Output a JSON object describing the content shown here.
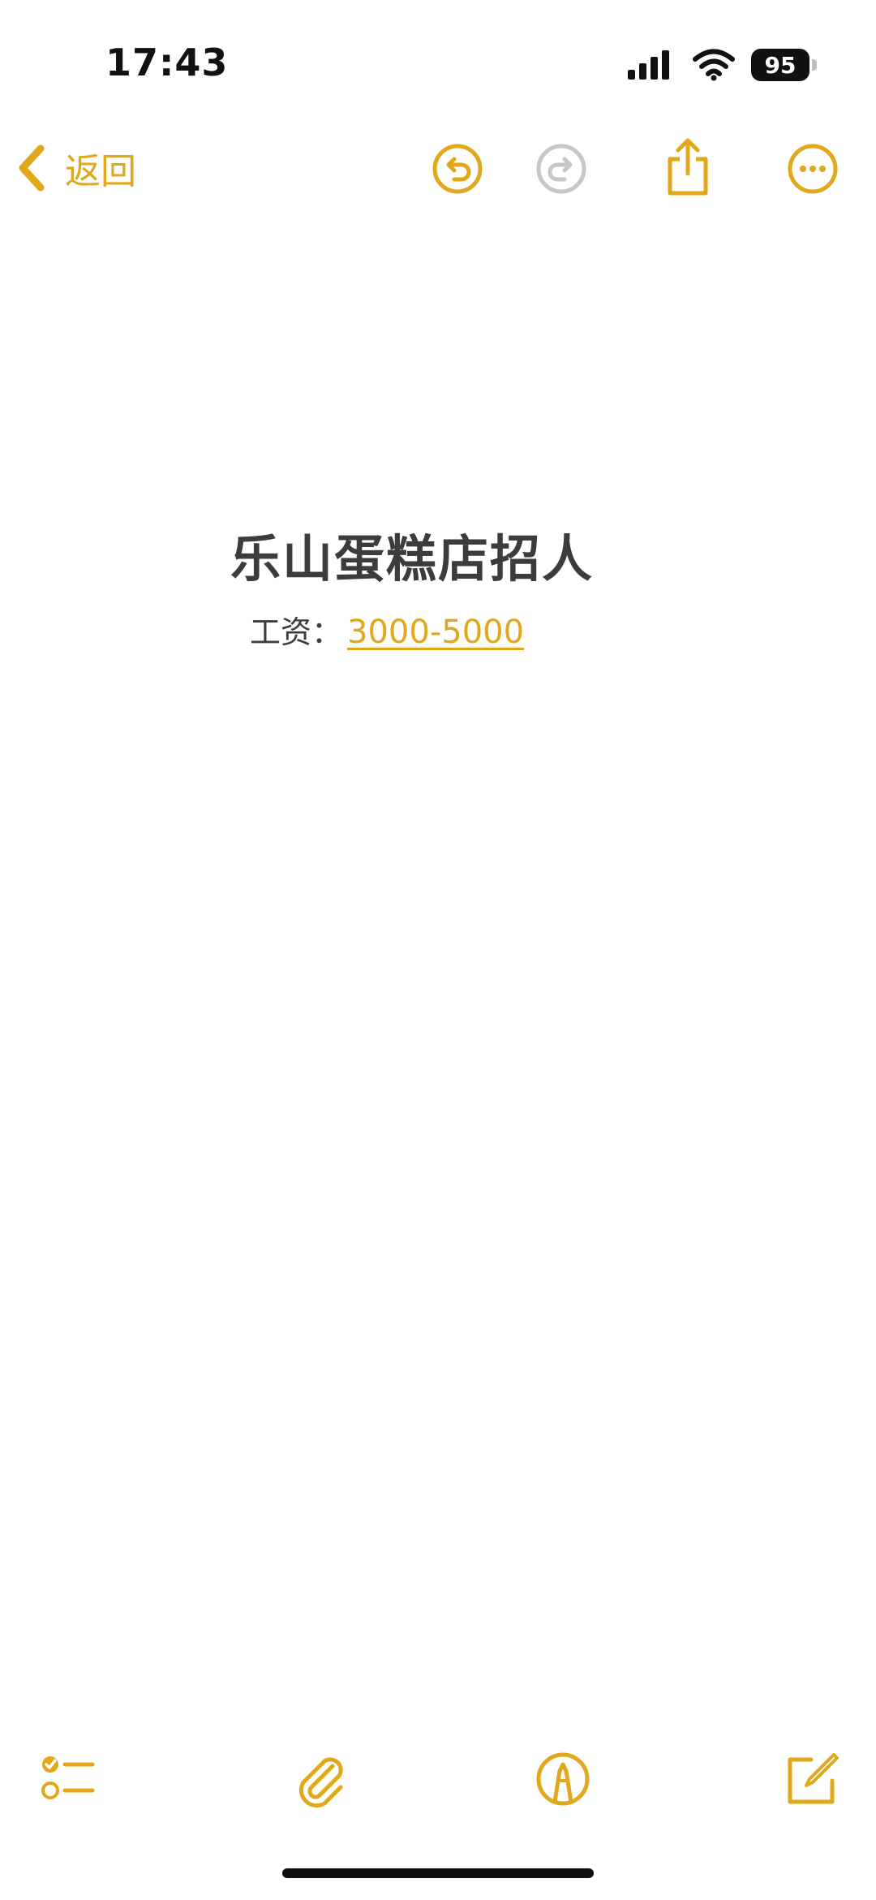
{
  "status_bar": {
    "time": "17:43",
    "battery": "95",
    "icons": [
      "signal-icon",
      "wifi-icon",
      "battery-icon"
    ]
  },
  "nav": {
    "back_label": "返回",
    "icons": [
      "undo-icon",
      "redo-icon",
      "share-icon",
      "more-icon"
    ]
  },
  "note": {
    "title": "乐山蛋糕店招人",
    "salary_label": "工资：",
    "salary_value": "3000-5000"
  },
  "toolbar": {
    "icons": [
      "checklist-icon",
      "paperclip-icon",
      "markup-icon",
      "compose-icon"
    ]
  },
  "colors": {
    "accent": "#e0a81a",
    "disabled": "#c7c7c7",
    "text": "#3c3c3c"
  }
}
